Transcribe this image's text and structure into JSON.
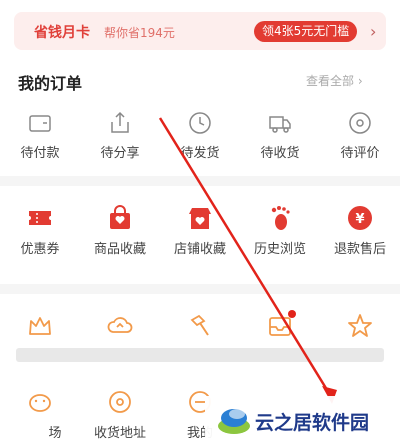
{
  "banner": {
    "title": "省钱月卡",
    "subtitle": "帮你省194元",
    "pill": "领4张5元无门槛",
    "arrow": "›"
  },
  "orders": {
    "title": "我的订单",
    "more": "查看全部 ›",
    "items": [
      {
        "label": "待付款",
        "icon": "wallet-icon"
      },
      {
        "label": "待分享",
        "icon": "share-icon"
      },
      {
        "label": "待发货",
        "icon": "clock-icon"
      },
      {
        "label": "待收货",
        "icon": "truck-icon"
      },
      {
        "label": "待评价",
        "icon": "review-icon"
      }
    ]
  },
  "services": {
    "items": [
      {
        "label": "优惠券",
        "icon": "coupon-icon"
      },
      {
        "label": "商品收藏",
        "icon": "bag-icon"
      },
      {
        "label": "店铺收藏",
        "icon": "shop-icon"
      },
      {
        "label": "历史浏览",
        "icon": "footprint-icon"
      },
      {
        "label": "退款售后",
        "icon": "refund-icon"
      }
    ]
  },
  "tools": {
    "items": [
      {
        "label": "",
        "icon": "crown-icon"
      },
      {
        "label": "",
        "icon": "cloud-icon"
      },
      {
        "label": "",
        "icon": "hammer-icon"
      },
      {
        "label": "",
        "icon": "envelope-icon"
      },
      {
        "label": "",
        "icon": "star-icon"
      }
    ],
    "row2": [
      {
        "label": "场",
        "icon": "piggy-icon"
      },
      {
        "label": "收货地址",
        "icon": "location-icon"
      },
      {
        "label": "我的",
        "icon": "more-icon"
      }
    ]
  },
  "watermark": {
    "text": "云之居软件园"
  },
  "colors": {
    "accent": "#e23b32",
    "orange": "#f29a4a"
  }
}
